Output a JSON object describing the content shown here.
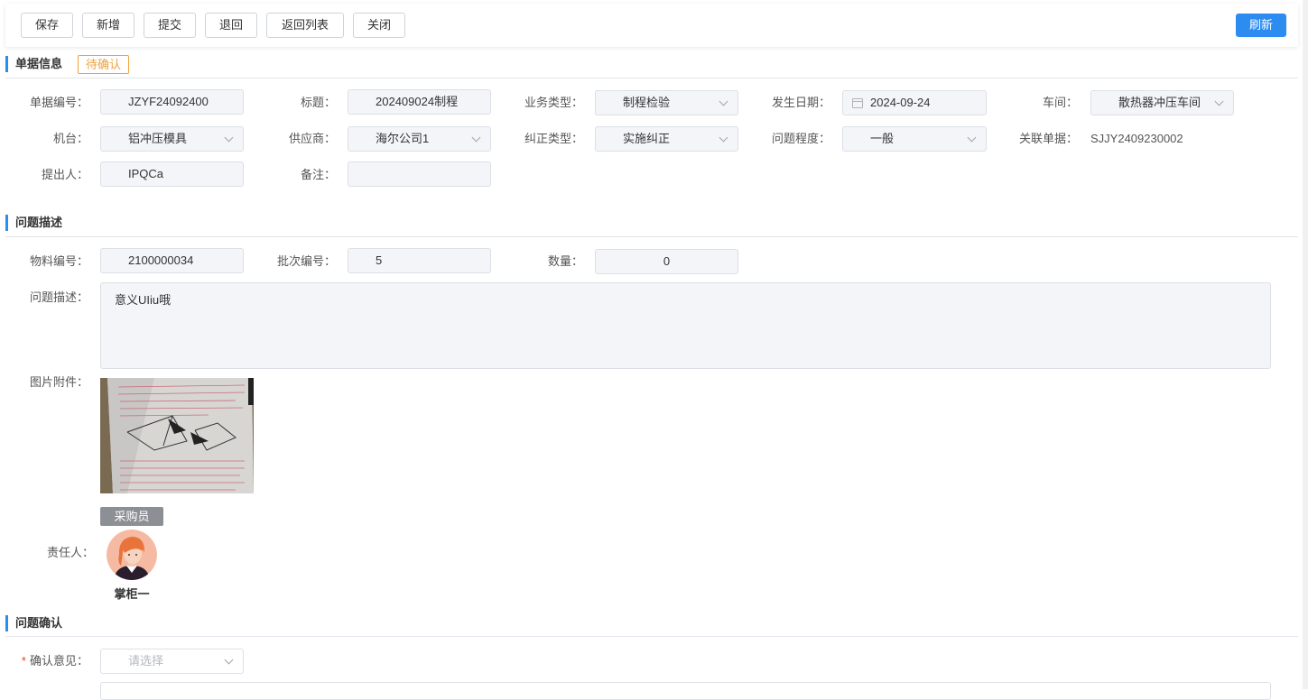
{
  "toolbar": {
    "save": "保存",
    "add": "新增",
    "submit": "提交",
    "reject": "退回",
    "back_to_list": "返回列表",
    "close": "关闭",
    "refresh": "刷新"
  },
  "doc_info": {
    "title": "单据信息",
    "status": "待确认",
    "fields": {
      "doc_no": {
        "label": "单据编号：",
        "value": "JZYF24092400"
      },
      "subject": {
        "label": "标题：",
        "value": "202409024制程"
      },
      "biz_type": {
        "label": "业务类型：",
        "value": "制程检验"
      },
      "occur_date": {
        "label": "发生日期：",
        "value": "2024-09-24"
      },
      "workshop": {
        "label": "车间：",
        "value": "散热器冲压车间"
      },
      "machine": {
        "label": "机台：",
        "value": "铝冲压模具"
      },
      "supplier": {
        "label": "供应商：",
        "value": "海尔公司1"
      },
      "correction_type": {
        "label": "纠正类型：",
        "value": "实施纠正"
      },
      "severity": {
        "label": "问题程度：",
        "value": "一般"
      },
      "related_doc": {
        "label": "关联单据：",
        "value": "SJJY2409230002"
      },
      "proposer": {
        "label": "提出人：",
        "value": "IPQCa"
      },
      "remark": {
        "label": "备注：",
        "value": ""
      }
    }
  },
  "problem_desc": {
    "title": "问题描述",
    "material_no": {
      "label": "物料编号：",
      "value": "2100000034"
    },
    "batch_no": {
      "label": "批次编号：",
      "value": "5"
    },
    "quantity": {
      "label": "数量：",
      "value": "0"
    },
    "description": {
      "label": "问题描述：",
      "value": "意义UIiu哦"
    },
    "attachment_label": "图片附件：",
    "responsible": {
      "label": "责任人：",
      "role": "采购员",
      "name": "掌柜一"
    }
  },
  "confirm": {
    "title": "问题确认",
    "opinion": {
      "label": "确认意见：",
      "required_mark": "*",
      "placeholder": "请选择"
    }
  },
  "colors": {
    "accent": "#2d8cf0",
    "status_orange": "#f0a23b",
    "required_red": "#ed4014"
  }
}
